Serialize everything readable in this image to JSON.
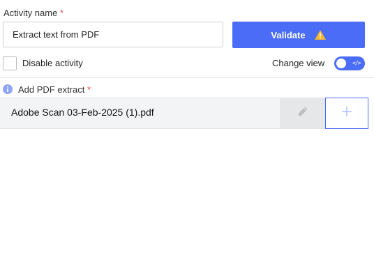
{
  "activity_name": {
    "label": "Activity name",
    "required_mark": "*",
    "value": "Extract text from PDF"
  },
  "validate_button": {
    "label": "Validate",
    "icon": "warning-icon",
    "icon_color": "#f5b82e",
    "background": "#4a6cf7"
  },
  "disable_activity": {
    "label": "Disable activity",
    "checked": false
  },
  "change_view": {
    "label": "Change view",
    "toggle_icon": "code-icon",
    "toggle_glyph": "</>",
    "on": true
  },
  "pdf_extract": {
    "label": "Add PDF extract",
    "required_mark": "*",
    "info_icon": "info-icon",
    "files": [
      {
        "name": "Adobe Scan 03-Feb-2025 (1).pdf"
      }
    ],
    "edit_icon": "pencil-icon",
    "add_icon": "plus-icon"
  }
}
